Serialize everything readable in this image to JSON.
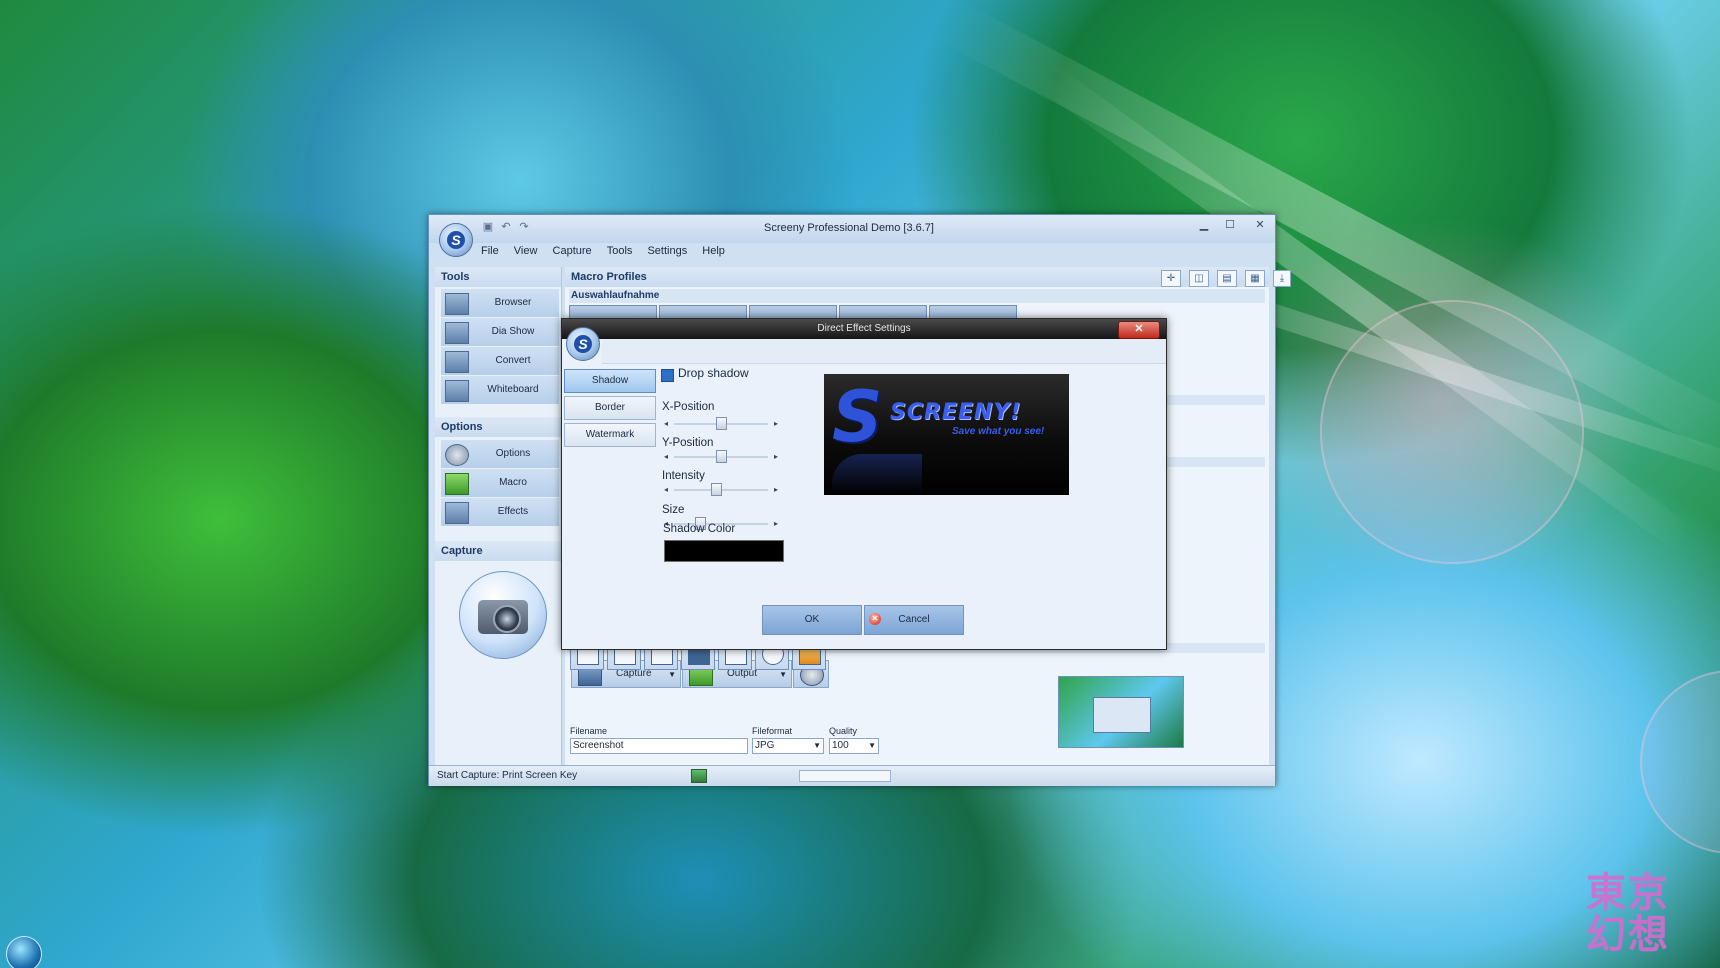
{
  "window": {
    "title": "Screeny Professional Demo [3.6.7]",
    "logo_letter": "S",
    "menu": [
      "File",
      "View",
      "Capture",
      "Tools",
      "Settings",
      "Help"
    ]
  },
  "sidebar": {
    "tools_header": "Tools",
    "tools": [
      "Browser",
      "Dia Show",
      "Convert",
      "Whiteboard"
    ],
    "options_header": "Options",
    "options": [
      "Options",
      "Macro",
      "Effects"
    ],
    "capture_header": "Capture"
  },
  "content": {
    "macro_profiles": "Macro Profiles",
    "auswahl": "Auswahlaufnahme"
  },
  "toolbar": {
    "capture_label": "Capture",
    "output_label": "Output",
    "filename_label": "Filename",
    "filename_value": "Screenshot",
    "fileformat_label": "Fileformat",
    "fileformat_value": "JPG",
    "quality_label": "Quality",
    "quality_value": "100"
  },
  "status": {
    "text": "Start Capture: Print Screen Key"
  },
  "dialog": {
    "title": "Direct Effect Settings",
    "close_glyph": "✕",
    "tabs": [
      "Shadow",
      "Border",
      "Watermark"
    ],
    "active_tab": "Shadow",
    "drop_shadow_label": "Drop shadow",
    "drop_shadow_checked": true,
    "sliders": [
      {
        "label": "X-Position",
        "value": 0.5
      },
      {
        "label": "Y-Position",
        "value": 0.5
      },
      {
        "label": "Intensity",
        "value": 0.45
      },
      {
        "label": "Size",
        "value": 0.25
      }
    ],
    "shadow_color_label": "Shadow Color",
    "shadow_color": "#000000",
    "preview": {
      "brand": "SCREENY!",
      "tagline": "Save what you see!"
    },
    "ok_label": "OK",
    "cancel_label": "Cancel"
  },
  "desktop": {
    "watermark": "東京幻想"
  }
}
